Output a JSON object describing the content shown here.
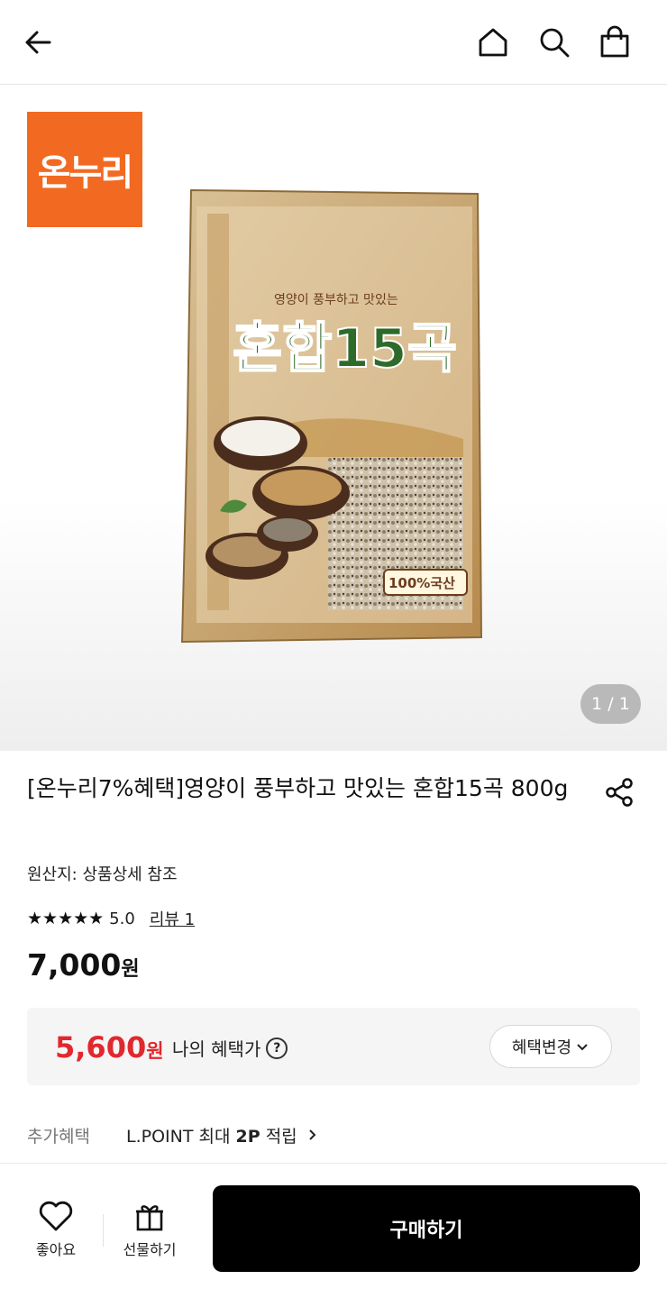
{
  "header": {
    "back_icon": "arrow-left-icon",
    "home_icon": "home-icon",
    "search_icon": "search-icon",
    "bag_icon": "shopping-bag-icon"
  },
  "gallery": {
    "brand_logo_text": "온누리",
    "brand_color": "#f26a21",
    "package_text_1": "영양이 풍부하고 맛있는",
    "package_text_2": "혼합15곡",
    "package_badge": "100%국산",
    "counter": "1 / 1"
  },
  "product": {
    "title": "[온누리7%혜택]영양이 풍부하고 맛있는 혼합15곡 800g",
    "origin": "원산지: 상품상세 참조",
    "stars": "★★★★★",
    "rating": "5.0",
    "review_link": "리뷰 1",
    "price_value": "7,000",
    "price_unit": "원"
  },
  "benefit": {
    "price_value": "5,600",
    "price_unit": "원",
    "label": "나의 혜택가",
    "help": "?",
    "change_button": "혜택변경",
    "price_color": "#e0282e"
  },
  "extra": {
    "label": "추가혜택",
    "value_prefix": "L.POINT 최대 ",
    "value_bold": "2P",
    "value_suffix": " 적립"
  },
  "bottom": {
    "like_label": "좋아요",
    "gift_label": "선물하기",
    "buy_label": "구매하기"
  }
}
